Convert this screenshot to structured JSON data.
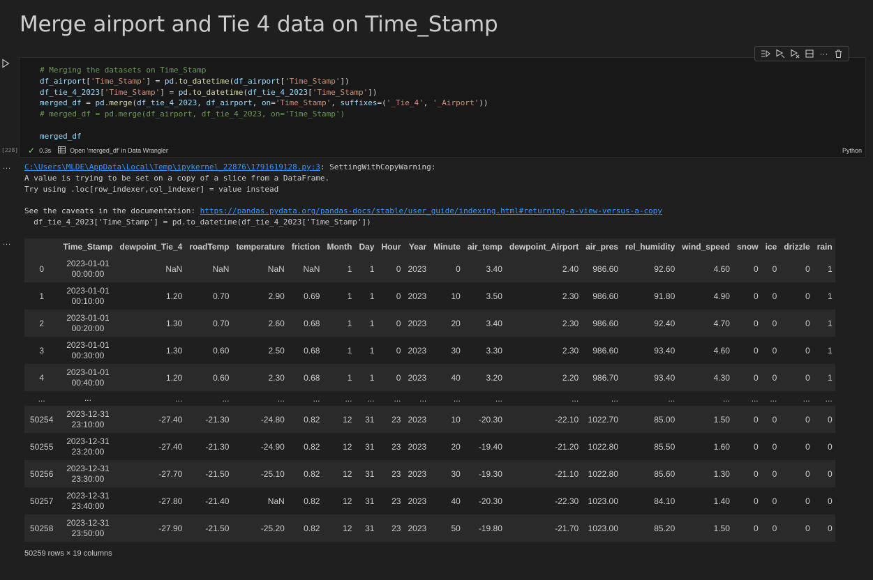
{
  "markdown": {
    "heading": "Merge airport and Tie 4 data on Time_Stamp"
  },
  "cell": {
    "code_lines": [
      [
        {
          "t": "# Merging the datasets on Time_Stamp",
          "c": "c-comment"
        }
      ],
      [
        {
          "t": "df_airport",
          "c": "c-var"
        },
        {
          "t": "[",
          "c": "c-plain"
        },
        {
          "t": "'Time_Stamp'",
          "c": "c-str"
        },
        {
          "t": "] = ",
          "c": "c-plain"
        },
        {
          "t": "pd",
          "c": "c-var"
        },
        {
          "t": ".",
          "c": "c-plain"
        },
        {
          "t": "to_datetime",
          "c": "c-fn"
        },
        {
          "t": "(",
          "c": "c-plain"
        },
        {
          "t": "df_airport",
          "c": "c-var"
        },
        {
          "t": "[",
          "c": "c-plain"
        },
        {
          "t": "'Time_Stamp'",
          "c": "c-str"
        },
        {
          "t": "])",
          "c": "c-plain"
        }
      ],
      [
        {
          "t": "df_tie_4_2023",
          "c": "c-var"
        },
        {
          "t": "[",
          "c": "c-plain"
        },
        {
          "t": "'Time_Stamp'",
          "c": "c-str"
        },
        {
          "t": "] = ",
          "c": "c-plain"
        },
        {
          "t": "pd",
          "c": "c-var"
        },
        {
          "t": ".",
          "c": "c-plain"
        },
        {
          "t": "to_datetime",
          "c": "c-fn"
        },
        {
          "t": "(",
          "c": "c-plain"
        },
        {
          "t": "df_tie_4_2023",
          "c": "c-var"
        },
        {
          "t": "[",
          "c": "c-plain"
        },
        {
          "t": "'Time_Stamp'",
          "c": "c-str"
        },
        {
          "t": "])",
          "c": "c-plain"
        }
      ],
      [
        {
          "t": "merged_df",
          "c": "c-var"
        },
        {
          "t": " = ",
          "c": "c-plain"
        },
        {
          "t": "pd",
          "c": "c-var"
        },
        {
          "t": ".",
          "c": "c-plain"
        },
        {
          "t": "merge",
          "c": "c-fn"
        },
        {
          "t": "(",
          "c": "c-plain"
        },
        {
          "t": "df_tie_4_2023",
          "c": "c-var"
        },
        {
          "t": ", ",
          "c": "c-plain"
        },
        {
          "t": "df_airport",
          "c": "c-var"
        },
        {
          "t": ", ",
          "c": "c-plain"
        },
        {
          "t": "on",
          "c": "c-var"
        },
        {
          "t": "=",
          "c": "c-plain"
        },
        {
          "t": "'Time_Stamp'",
          "c": "c-str"
        },
        {
          "t": ", ",
          "c": "c-plain"
        },
        {
          "t": "suffixes",
          "c": "c-var"
        },
        {
          "t": "=(",
          "c": "c-plain"
        },
        {
          "t": "'_Tie_4'",
          "c": "c-str"
        },
        {
          "t": ", ",
          "c": "c-plain"
        },
        {
          "t": "'_Airport'",
          "c": "c-str"
        },
        {
          "t": "))",
          "c": "c-plain"
        }
      ],
      [
        {
          "t": "# merged_df = pd.merge(df_airport, df_tie_4_2023, on='Time_Stamp')",
          "c": "c-comment"
        }
      ],
      [
        {
          "t": "",
          "c": "c-plain"
        }
      ],
      [
        {
          "t": "merged_df",
          "c": "c-var"
        }
      ]
    ],
    "execution_count": "[228]",
    "status_time": "0.3s",
    "wrangler_link": "Open 'merged_df' in Data Wrangler",
    "language": "Python"
  },
  "output": {
    "warning_path": "C:\\Users\\MLDE\\AppData\\Local\\Temp\\ipykernel_22876\\1791619128.py:3",
    "warning_title": ": SettingWithCopyWarning:",
    "warning_lines": [
      "A value is trying to be set on a copy of a slice from a DataFrame.",
      "Try using .loc[row_indexer,col_indexer] = value instead",
      ""
    ],
    "caveats_prefix": "See the caveats in the documentation: ",
    "caveats_link": "https://pandas.pydata.org/pandas-docs/stable/user_guide/indexing.html#returning-a-view-versus-a-copy",
    "code_echo": "  df_tie_4_2023['Time_Stamp'] = pd.to_datetime(df_tie_4_2023['Time_Stamp'])",
    "table": {
      "columns": [
        "",
        "Time_Stamp",
        "dewpoint_Tie_4",
        "roadTemp",
        "temperature",
        "friction",
        "Month",
        "Day",
        "Hour",
        "Year",
        "Minute",
        "air_temp",
        "dewpoint_Airport",
        "air_pres",
        "rel_humidity",
        "wind_speed",
        "snow",
        "ice",
        "drizzle",
        "rain"
      ],
      "rows": [
        [
          "0",
          "2023-01-01\n00:00:00",
          "NaN",
          "NaN",
          "NaN",
          "NaN",
          "1",
          "1",
          "0",
          "2023",
          "0",
          "3.40",
          "2.40",
          "986.60",
          "92.60",
          "4.60",
          "0",
          "0",
          "0",
          "1"
        ],
        [
          "1",
          "2023-01-01\n00:10:00",
          "1.20",
          "0.70",
          "2.90",
          "0.69",
          "1",
          "1",
          "0",
          "2023",
          "10",
          "3.50",
          "2.30",
          "986.60",
          "91.80",
          "4.90",
          "0",
          "0",
          "0",
          "1"
        ],
        [
          "2",
          "2023-01-01\n00:20:00",
          "1.30",
          "0.70",
          "2.60",
          "0.68",
          "1",
          "1",
          "0",
          "2023",
          "20",
          "3.40",
          "2.30",
          "986.60",
          "92.40",
          "4.70",
          "0",
          "0",
          "0",
          "1"
        ],
        [
          "3",
          "2023-01-01\n00:30:00",
          "1.30",
          "0.60",
          "2.50",
          "0.68",
          "1",
          "1",
          "0",
          "2023",
          "30",
          "3.30",
          "2.30",
          "986.60",
          "93.40",
          "4.60",
          "0",
          "0",
          "0",
          "1"
        ],
        [
          "4",
          "2023-01-01\n00:40:00",
          "1.20",
          "0.60",
          "2.30",
          "0.68",
          "1",
          "1",
          "0",
          "2023",
          "40",
          "3.20",
          "2.20",
          "986.70",
          "93.40",
          "4.30",
          "0",
          "0",
          "0",
          "1"
        ],
        [
          "...",
          "...",
          "...",
          "...",
          "...",
          "...",
          "...",
          "...",
          "...",
          "...",
          "...",
          "...",
          "...",
          "...",
          "...",
          "...",
          "...",
          "...",
          "...",
          "..."
        ],
        [
          "50254",
          "2023-12-31\n23:10:00",
          "-27.40",
          "-21.30",
          "-24.80",
          "0.82",
          "12",
          "31",
          "23",
          "2023",
          "10",
          "-20.30",
          "-22.10",
          "1022.70",
          "85.00",
          "1.50",
          "0",
          "0",
          "0",
          "0"
        ],
        [
          "50255",
          "2023-12-31\n23:20:00",
          "-27.40",
          "-21.30",
          "-24.90",
          "0.82",
          "12",
          "31",
          "23",
          "2023",
          "20",
          "-19.40",
          "-21.20",
          "1022.80",
          "85.50",
          "1.60",
          "0",
          "0",
          "0",
          "0"
        ],
        [
          "50256",
          "2023-12-31\n23:30:00",
          "-27.70",
          "-21.50",
          "-25.10",
          "0.82",
          "12",
          "31",
          "23",
          "2023",
          "30",
          "-19.30",
          "-21.10",
          "1022.80",
          "85.60",
          "1.30",
          "0",
          "0",
          "0",
          "0"
        ],
        [
          "50257",
          "2023-12-31\n23:40:00",
          "-27.80",
          "-21.40",
          "NaN",
          "0.82",
          "12",
          "31",
          "23",
          "2023",
          "40",
          "-20.30",
          "-22.30",
          "1023.00",
          "84.10",
          "1.40",
          "0",
          "0",
          "0",
          "0"
        ],
        [
          "50258",
          "2023-12-31\n23:50:00",
          "-27.90",
          "-21.50",
          "-25.20",
          "0.82",
          "12",
          "31",
          "23",
          "2023",
          "50",
          "-19.80",
          "-21.70",
          "1023.00",
          "85.20",
          "1.50",
          "0",
          "0",
          "0",
          "0"
        ]
      ]
    },
    "shape": "50259 rows × 19 columns"
  },
  "icons": {
    "run": "run-cell-icon",
    "toolbar": [
      "execute-above-icon",
      "execute-cell-below-icon",
      "execute-below-icon",
      "split-cell-icon",
      "more-actions-icon",
      "delete-cell-icon"
    ]
  }
}
